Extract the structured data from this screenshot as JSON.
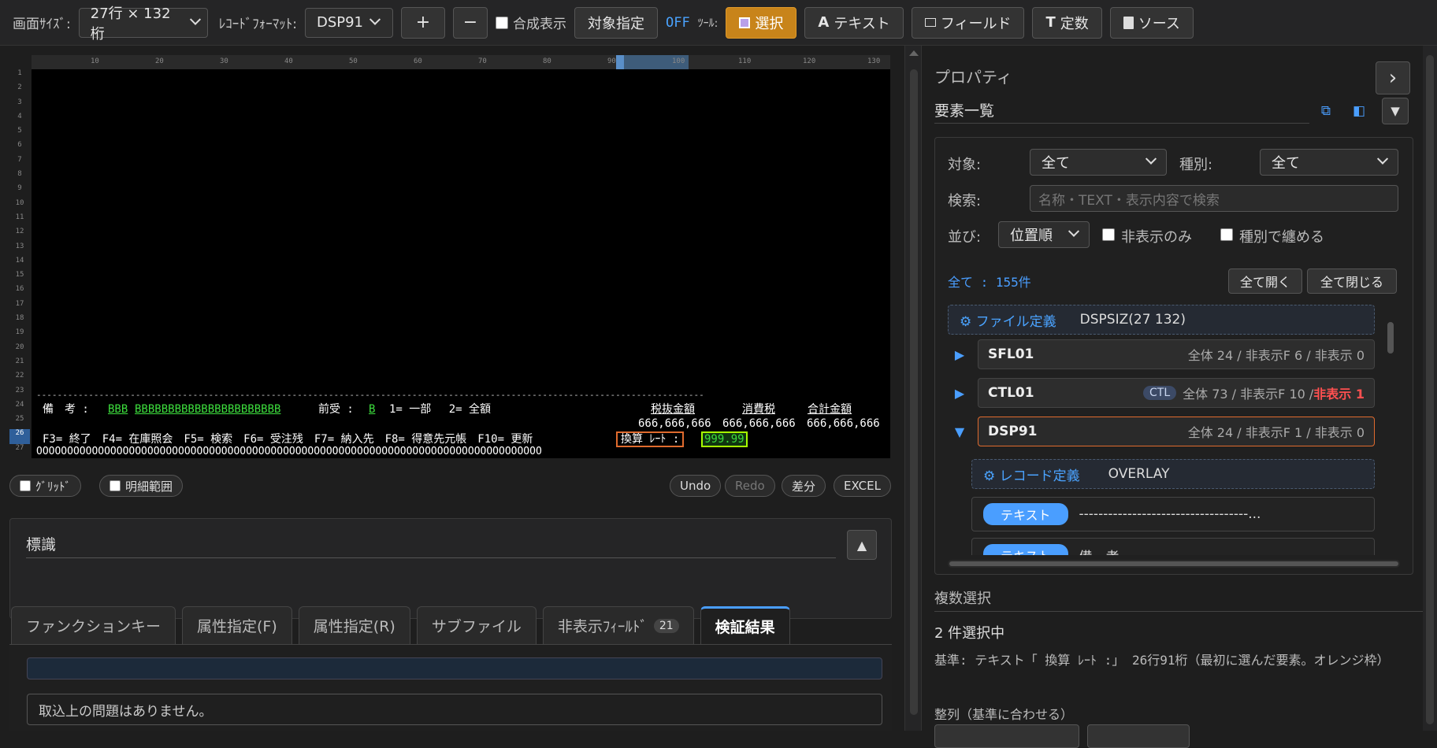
{
  "toolbar": {
    "screen_size_label": "画面ｻｲｽﾞ:",
    "screen_size_value": "27行 × 132桁",
    "record_format_label": "ﾚｺｰﾄﾞﾌｫｰﾏｯﾄ:",
    "record_format_value": "DSP91",
    "plus": "+",
    "minus": "−",
    "composite_label": "合成表示",
    "target_button": "対象指定",
    "off_text": "OFF",
    "tool_label": "ﾂｰﾙ:",
    "tools": [
      "選択",
      "テキスト",
      "フィールド",
      "定数",
      "ソース"
    ],
    "tool_icons": [
      "square-icon",
      "text-icon",
      "field-icon",
      "constant-icon",
      "document-icon"
    ]
  },
  "ruler": {
    "ticks": [
      "10",
      "20",
      "30",
      "40",
      "50",
      "60",
      "70",
      "80",
      "90",
      "100",
      "110",
      "120",
      "130"
    ]
  },
  "rows": [
    "1",
    "2",
    "3",
    "4",
    "5",
    "6",
    "7",
    "8",
    "9",
    "10",
    "11",
    "12",
    "13",
    "14",
    "15",
    "16",
    "17",
    "18",
    "19",
    "20",
    "21",
    "22",
    "23",
    "24",
    "25",
    "26",
    "27"
  ],
  "screen": {
    "separator": "--------------------------------------------------------------------------------------------------------------------------------",
    "row24_label": "備　考 :",
    "row24_bbb": "BBB",
    "row24_bbbb": "BBBBBBBBBBBBBBBBBBBBBB",
    "row24_maeuke": "前受 :",
    "row24_b": "B",
    "row24_opts": "1= 一部　 2= 全額",
    "h_zeinuki": "税抜金額",
    "h_shohizei": "消費税",
    "h_gokei": "合計金額",
    "v_zeinuki": "666,666,666",
    "v_shohizei": "666,666,666",
    "v_gokei": "666,666,666",
    "fkeys": "F3= 終了　F4= 在庫照会　F5= 検索　F6= 受注残　F7= 納入先　F8= 得意先元帳　F10= 更新",
    "rate_label": "換算 ﾚｰﾄ :",
    "rate_value": "999.99",
    "row27": "OOOOOOOOOOOOOOOOOOOOOOOOOOOOOOOOOOOOOOOOOOOOOOOOOOOOOOOOOOOOOOOOOOOOOOOOOOOOOOOOOO"
  },
  "canvasbar": {
    "grid_label": "ｸﾞﾘｯﾄﾞ",
    "detail_label": "明細範囲",
    "undo": "Undo",
    "redo": "Redo",
    "diff": "差分",
    "excel": "EXCEL"
  },
  "hyoshiki": {
    "title": "標識",
    "toggle": "▲"
  },
  "tabs": [
    {
      "label": "ファンクションキー"
    },
    {
      "label": "属性指定(F)"
    },
    {
      "label": "属性指定(R)"
    },
    {
      "label": "サブファイル"
    },
    {
      "label": "非表示ﾌｨｰﾙﾄﾞ",
      "badge": "21"
    },
    {
      "label": "検証結果"
    }
  ],
  "validation": {
    "message": "取込上の問題はありません。"
  },
  "properties": {
    "title": "プロパティ",
    "collapse": "›",
    "elements_title": "要素一覧",
    "target_label": "対象:",
    "target_value": "全て",
    "kind_label": "種別:",
    "kind_value": "全て",
    "search_label": "検索:",
    "search_placeholder": "名称・TEXT・表示内容で検索",
    "sort_label": "並び:",
    "sort_value": "位置順",
    "hidden_only": "非表示のみ",
    "group_by_kind": "種別で纏める",
    "count": "全て : 155件",
    "expand_all": "全て開く",
    "collapse_all": "全て閉じる",
    "file_def_key": "ファイル定義",
    "file_def_val": "DSPSIZ(27 132)",
    "nodes": [
      {
        "name": "SFL01",
        "meta": "全体 24 / 非表示F 6 / 非表示 0"
      },
      {
        "name": "CTL01",
        "badge": "CTL",
        "meta": "全体 73 / 非表示F 10 / ",
        "meta_red": "非表示 1"
      },
      {
        "name": "DSP91",
        "meta": "全体 24 / 非表示F 1 / 非表示 0"
      }
    ],
    "rec_def_key": "レコード定義",
    "rec_def_val": "OVERLAY",
    "item_tag": "テキスト",
    "item_text": "-----------------------------------...",
    "item2_text": "備　考"
  },
  "multi": {
    "title": "複数選択",
    "count": "2 件選択中",
    "basis": "基準: テキスト「 換算 ﾚｰﾄ :」 26行91桁（最初に選んだ要素。オレンジ枠）",
    "align_title": "整列（基準に合わせる）"
  }
}
